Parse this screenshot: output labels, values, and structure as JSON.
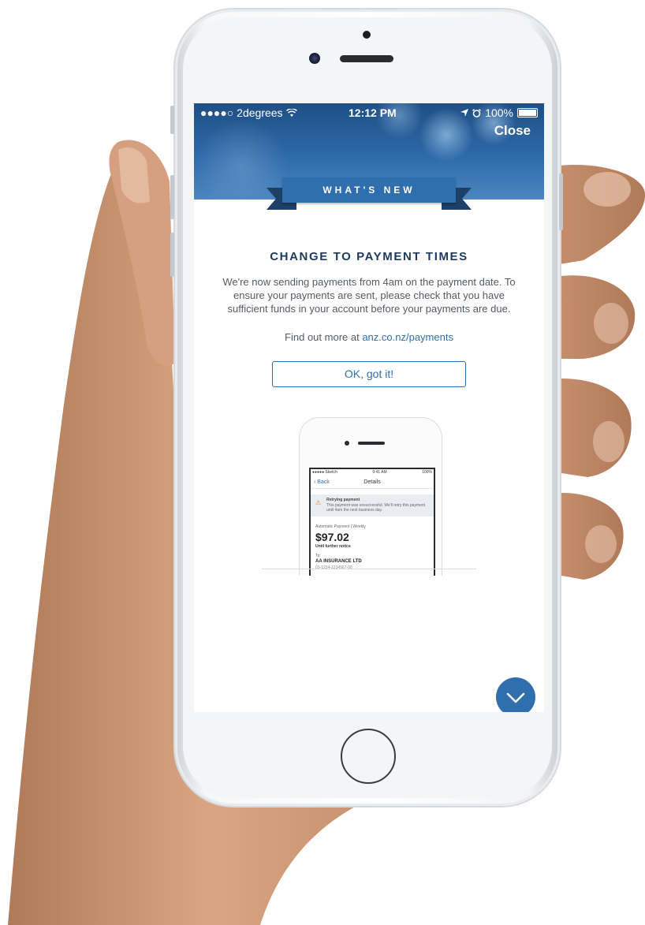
{
  "status_bar": {
    "carrier": "●●●●○ 2degrees",
    "time": "12:12 PM",
    "battery": "100%"
  },
  "header": {
    "close_label": "Close",
    "ribbon_label": "WHAT'S NEW"
  },
  "content": {
    "title": "CHANGE TO PAYMENT TIMES",
    "body": "We're now sending payments from 4am on the payment date. To ensure your payments are sent, please check that you have sufficient funds in your account before your payments are due.",
    "find_out_prefix": "Find out more at ",
    "find_out_link": "anz.co.nz/payments",
    "ok_button": "OK, got it!"
  },
  "preview": {
    "status_carrier": "●●●●● Sketch",
    "status_time": "9:41 AM",
    "status_battery": "100%",
    "back_label": "Back",
    "nav_title": "Details",
    "alert_title": "Retrying payment",
    "alert_text": "This payment was unsuccessful. We'll retry this payment until 4am the next business day.",
    "payment_type": "Automatic Payment | Weekly",
    "amount": "$97.02",
    "until": "Until further notice",
    "to_label": "To:",
    "payee": "AA INSURANCE LTD",
    "account": "01-1234-1234567-00"
  },
  "colors": {
    "accent": "#2f6fae",
    "title": "#1d3a5c",
    "ribbon_tail": "#1e3f66"
  },
  "icons": {
    "wifi": "wifi-icon",
    "location": "location-arrow-icon",
    "alarm": "alarm-icon",
    "battery": "battery-icon",
    "scroll": "chevron-down-icon"
  }
}
